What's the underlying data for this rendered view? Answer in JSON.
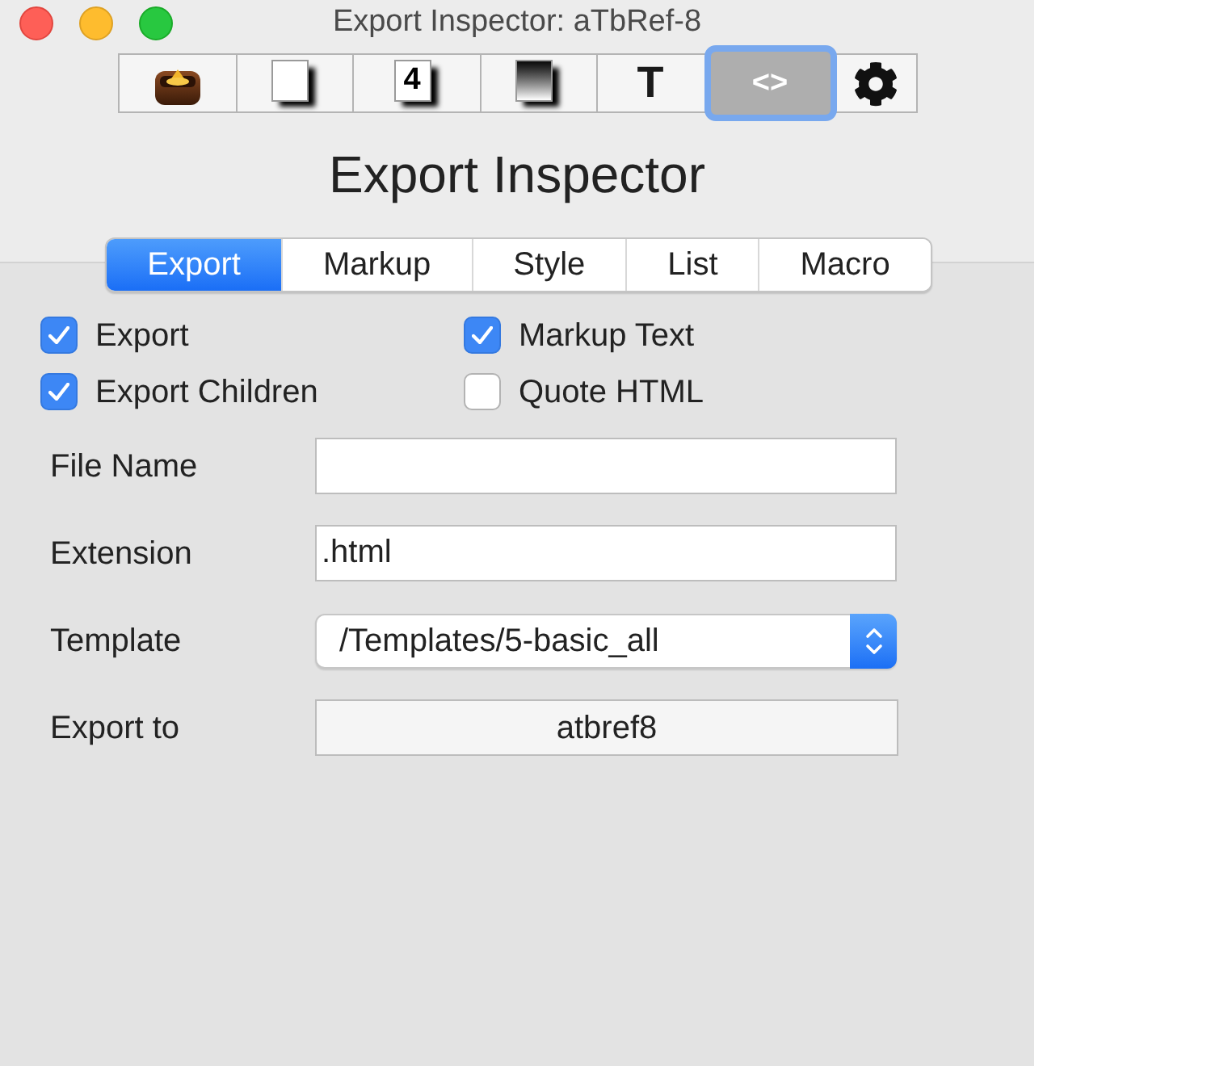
{
  "window": {
    "title": "Export Inspector: aTbRef-8"
  },
  "toolbar": [
    {
      "kind": "box",
      "selected": false
    },
    {
      "kind": "page",
      "selected": false
    },
    {
      "kind": "numbered-page",
      "glyph": "4",
      "selected": false
    },
    {
      "kind": "shaded-page",
      "selected": false
    },
    {
      "kind": "letter",
      "glyph": "T",
      "selected": false
    },
    {
      "kind": "letter",
      "glyph": "<>",
      "selected": true
    },
    {
      "kind": "gear",
      "selected": false
    }
  ],
  "heading": "Export Inspector",
  "tabs": [
    {
      "label": "Export",
      "selected": true
    },
    {
      "label": "Markup",
      "selected": false
    },
    {
      "label": "Style",
      "selected": false
    },
    {
      "label": "List",
      "selected": false
    },
    {
      "label": "Macro",
      "selected": false
    }
  ],
  "checkboxes": [
    {
      "label": "Export",
      "checked": true
    },
    {
      "label": "Markup Text",
      "checked": true
    },
    {
      "label": "Export Children",
      "checked": true
    },
    {
      "label": "Quote HTML",
      "checked": false
    }
  ],
  "fields": [
    {
      "kind": "text",
      "label": "File Name"
    },
    {
      "kind": "text",
      "label": "Extension",
      "value": ".html"
    },
    {
      "kind": "popup",
      "label": "Template",
      "value": "/Templates/5-basic_all"
    },
    {
      "kind": "button",
      "label": "Export to",
      "value": "atbref8"
    }
  ]
}
